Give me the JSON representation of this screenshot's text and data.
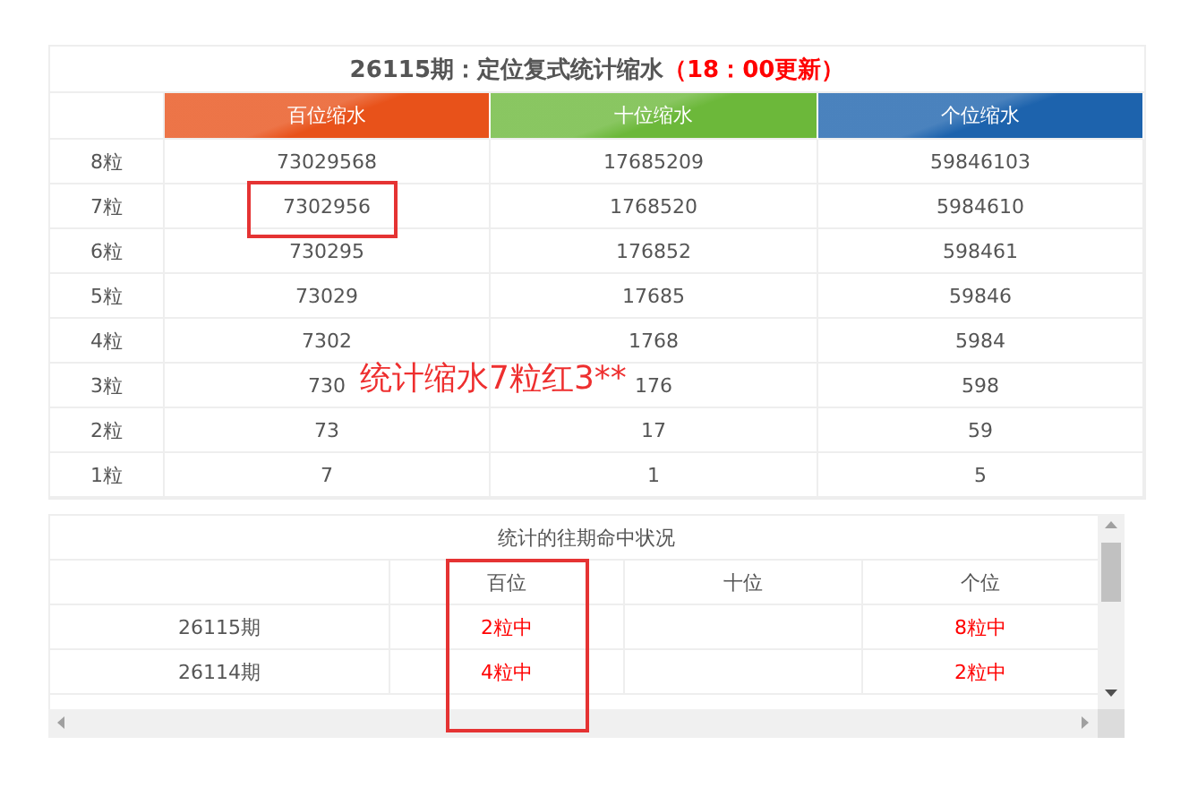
{
  "stats_table": {
    "title": "26115期：定位复式统计缩水",
    "update_note": "（18：00更新）",
    "columns": [
      {
        "label": "百位缩水",
        "color": "#e8521a"
      },
      {
        "label": "十位缩水",
        "color": "#6cb83a"
      },
      {
        "label": "个位缩水",
        "color": "#1d63ad"
      }
    ],
    "rows": [
      {
        "label": "8粒",
        "values": [
          "73029568",
          "17685209",
          "59846103"
        ]
      },
      {
        "label": "7粒",
        "values": [
          "7302956",
          "1768520",
          "5984610"
        ]
      },
      {
        "label": "6粒",
        "values": [
          "730295",
          "176852",
          "598461"
        ]
      },
      {
        "label": "5粒",
        "values": [
          "73029",
          "17685",
          "59846"
        ]
      },
      {
        "label": "4粒",
        "values": [
          "7302",
          "1768",
          "5984"
        ]
      },
      {
        "label": "3粒",
        "values": [
          "730",
          "176",
          "598"
        ]
      },
      {
        "label": "2粒",
        "values": [
          "73",
          "17",
          "59"
        ]
      },
      {
        "label": "1粒",
        "values": [
          "7",
          "1",
          "5"
        ]
      }
    ]
  },
  "annotation": "统计缩水7粒红3**",
  "history_table": {
    "title": "统计的往期命中状况",
    "columns": [
      "百位",
      "十位",
      "个位"
    ],
    "rows": [
      {
        "issue": "26115期",
        "cells": [
          "2粒中",
          null,
          "8粒中"
        ]
      },
      {
        "issue": "26114期",
        "cells": [
          "4粒中",
          null,
          "2粒中"
        ]
      }
    ]
  }
}
